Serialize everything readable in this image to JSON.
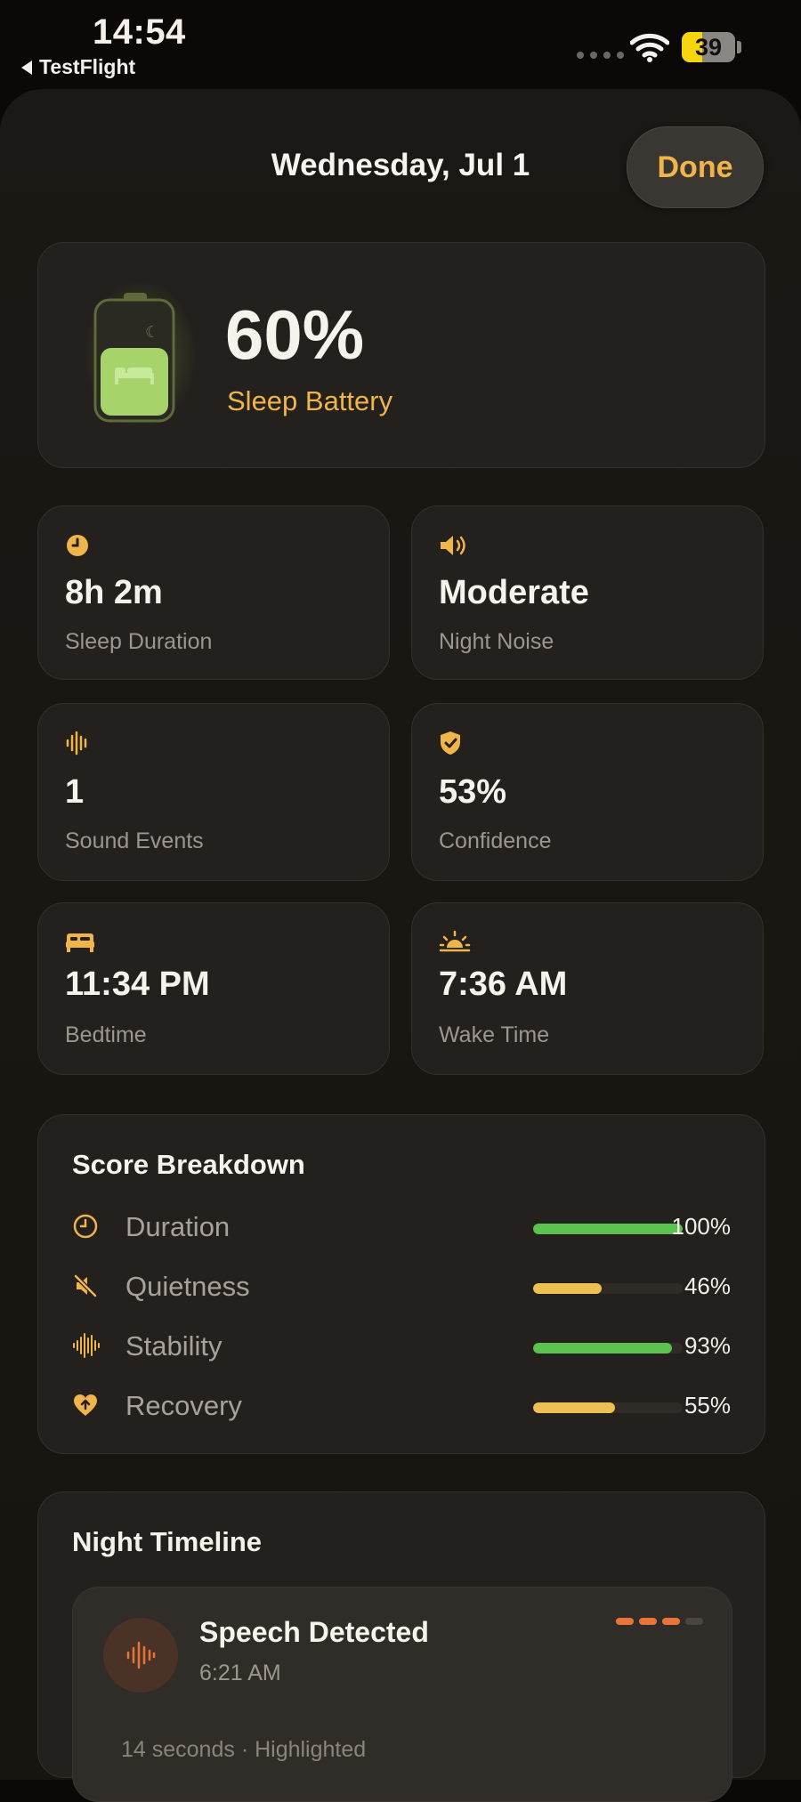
{
  "status_bar": {
    "time": "14:54",
    "back_label": "TestFlight",
    "battery_percent": "39",
    "battery_level": 0.39
  },
  "header": {
    "date": "Wednesday, Jul 1",
    "done_label": "Done"
  },
  "hero": {
    "percent": "60%",
    "label": "Sleep Battery",
    "battery_fill": 0.6
  },
  "stats": [
    {
      "value": "8h 2m",
      "label": "Sleep Duration",
      "icon": "clock-icon"
    },
    {
      "value": "Moderate",
      "label": "Night Noise",
      "icon": "speaker-icon"
    },
    {
      "value": "1",
      "label": "Sound Events",
      "icon": "waveform-icon"
    },
    {
      "value": "53%",
      "label": "Confidence",
      "icon": "shield-check-icon"
    },
    {
      "value": "11:34 PM",
      "label": "Bedtime",
      "icon": "bed-icon"
    },
    {
      "value": "7:36 AM",
      "label": "Wake Time",
      "icon": "sunrise-icon"
    }
  ],
  "score_breakdown": {
    "title": "Score Breakdown",
    "rows": [
      {
        "name": "Duration",
        "percent": "100%",
        "level": 1.0,
        "color": "#5cc24f",
        "icon": "clock-icon"
      },
      {
        "name": "Quietness",
        "percent": "46%",
        "level": 0.46,
        "color": "#eebf55",
        "icon": "muted-speaker-icon"
      },
      {
        "name": "Stability",
        "percent": "93%",
        "level": 0.93,
        "color": "#5cc24f",
        "icon": "waveform-icon"
      },
      {
        "name": "Recovery",
        "percent": "55%",
        "level": 0.55,
        "color": "#eebf55",
        "icon": "heart-arrow-icon"
      }
    ]
  },
  "timeline": {
    "title": "Night Timeline",
    "events": [
      {
        "title": "Speech Detected",
        "time": "6:21 AM",
        "note": "14 seconds · Highlighted",
        "severity_filled": 3,
        "severity_total": 4,
        "icon": "waveform-icon"
      }
    ]
  },
  "colors": {
    "accent": "#f0b54a",
    "good": "#5cc24f",
    "warn": "#eebf55",
    "event": "#e8743a"
  }
}
